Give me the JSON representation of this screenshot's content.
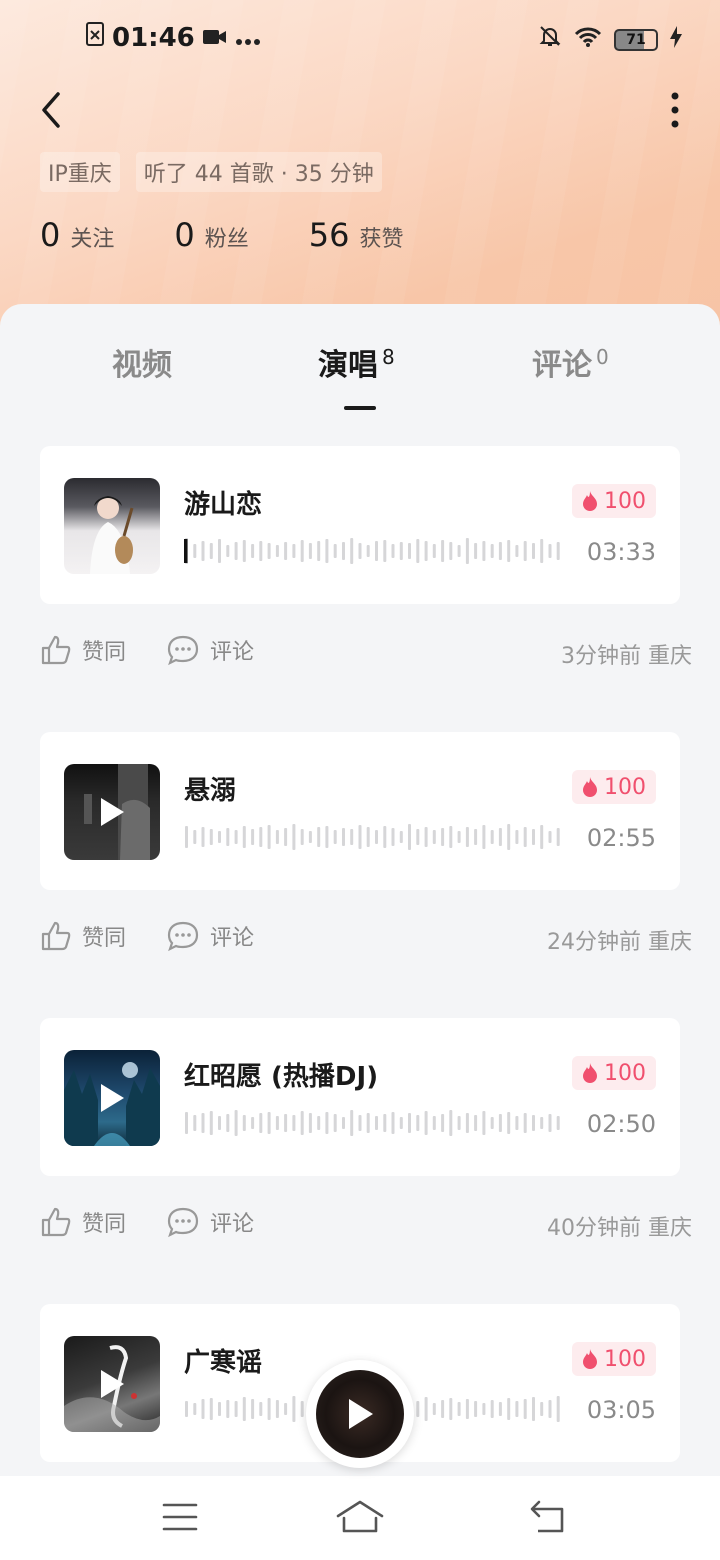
{
  "status_bar": {
    "time": "01:46",
    "battery": "71"
  },
  "profile": {
    "tags": [
      "IP重庆",
      "听了 44 首歌 · 35 分钟"
    ],
    "stats": [
      {
        "num": "0",
        "label": "关注"
      },
      {
        "num": "0",
        "label": "粉丝"
      },
      {
        "num": "56",
        "label": "获赞"
      }
    ]
  },
  "tabs": [
    {
      "label": "视频",
      "count": ""
    },
    {
      "label": "演唱",
      "count": "8"
    },
    {
      "label": "评论",
      "count": "0"
    }
  ],
  "songs": [
    {
      "title": "游山恋",
      "heat": "100",
      "duration": "03:33",
      "like_label": "赞同",
      "comment_label": "评论",
      "meta": "3分钟前 重庆",
      "progress": 0.0
    },
    {
      "title": "悬溺",
      "heat": "100",
      "duration": "02:55",
      "like_label": "赞同",
      "comment_label": "评论",
      "meta": "24分钟前 重庆",
      "progress": 0.0
    },
    {
      "title": "红昭愿 (热播DJ)",
      "heat": "100",
      "duration": "02:50",
      "like_label": "赞同",
      "comment_label": "评论",
      "meta": "40分钟前 重庆",
      "progress": 0.0
    },
    {
      "title": "广寒谣",
      "heat": "100",
      "duration": "03:05"
    }
  ],
  "icons": {
    "back": "chevron-left-icon",
    "more": "more-vertical-icon",
    "like": "thumb-up-icon",
    "comment": "comment-bubble-icon",
    "fire": "fire-icon",
    "play": "play-icon"
  },
  "colors": {
    "accent": "#f0506e",
    "hero_start": "#fde9dd",
    "hero_end": "#f7c4a5"
  }
}
